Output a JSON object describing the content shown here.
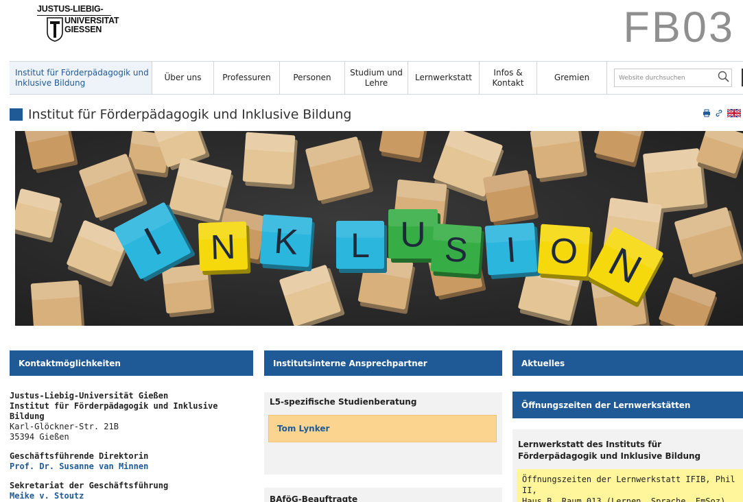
{
  "header": {
    "logo": {
      "line1": "JUSTUS-LIEBIG-",
      "line2": "UNIVERSITAT",
      "line3": "GIESSEN"
    },
    "faculty": "FB03"
  },
  "nav": {
    "home": "Institut für Förderpädagogik und Inklusive Bildung",
    "items": [
      "Über uns",
      "Professuren",
      "Personen",
      "Studium und Lehre",
      "Lernwerkstatt",
      "Infos & Kontakt",
      "Gremien"
    ],
    "search_placeholder": "Website durchsuchen"
  },
  "page": {
    "title": "Institut für Förderpädagogik und Inklusive Bildung",
    "tools": [
      "print-icon",
      "link-icon",
      "uk-flag-icon"
    ]
  },
  "hero": {
    "letters": [
      "I",
      "N",
      "K",
      "L",
      "U",
      "S",
      "I",
      "O",
      "N"
    ],
    "colors": {
      "cyan": "#2bb6de",
      "yellow": "#f5d90c",
      "green": "#36ae45",
      "wood": "#d7b07c"
    }
  },
  "columns": {
    "contact": {
      "heading": "Kontaktmöglichkeiten",
      "org1": "Justus-Liebig-Universität Gießen",
      "org2": "Institut für Förderpädagogik und Inklusive Bildung",
      "street": "Karl-Glöckner-Str. 21B",
      "city": "35394 Gießen",
      "director_label": "Geschäftsführende Direktorin",
      "director_name": "Prof. Dr. Susanne van Minnen",
      "secretariat_label": "Sekretariat der Geschäftsführung",
      "secretariat_name": "Meike v. Stoutz"
    },
    "internal": {
      "heading": "Institutsinterne Ansprechpartner",
      "box1_title": "L5-spezifische Studienberatung",
      "box1_person": "Tom Lynker",
      "box2_title": "BAföG-Beauftragte"
    },
    "news": {
      "heading": "Aktuelles",
      "sub_heading": "Öffnungszeiten der Lernwerkstätten",
      "box_title": "Lernwerkstatt des Instituts für Förderpädagogik und Inklusive Bildung",
      "box_line1": "Öffnungszeiten der Lernwerkstatt IFIB, Phil II,",
      "box_line2": "Haus B, Raum 013 (Lernen, Sprache, EmSoz)"
    }
  },
  "colors": {
    "brand_blue": "#1f5a96",
    "highlight_orange": "#fbd58f",
    "highlight_yellow": "#fff59a"
  }
}
